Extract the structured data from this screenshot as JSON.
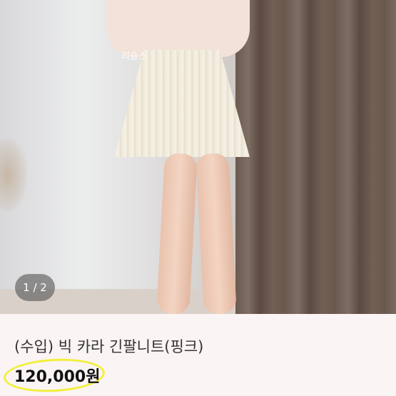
{
  "product": {
    "image_counter": "1 / 2",
    "watermark": "리슬스",
    "title": "(수입) 빅 카라 긴팔니트(핑크)",
    "price": "120,000원"
  },
  "colors": {
    "background": "#fbf4f4",
    "highlight": "#f2ef3a",
    "counter_bg": "#464646"
  }
}
